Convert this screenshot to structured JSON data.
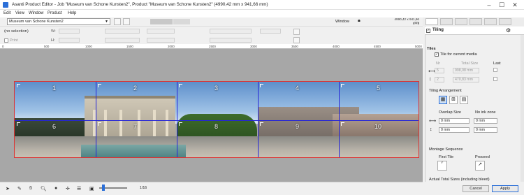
{
  "window": {
    "title": "Asanti Product Editor - Job \"Museum van Schone Kunsten2\", Product \"Museum van Schone Kunsten2\" (4990,42 mm x 941,66 mm)"
  },
  "menu": [
    "Edit",
    "View",
    "Window",
    "Product",
    "Help"
  ],
  "toolbar": {
    "product_select": "Museum van Schone Kunsten2",
    "window_label": "Window",
    "size_readout": "4990,42 x 941,66 mm",
    "page_readout": "8 / 1"
  },
  "properties": {
    "selection": "(no selection)",
    "print_label": "Print",
    "w_label": "W:",
    "h_label": "H:"
  },
  "ruler": {
    "ticks": [
      "0",
      "500",
      "1000",
      "1500",
      "2000",
      "2500",
      "3000",
      "3500",
      "4000",
      "4500",
      "5000"
    ]
  },
  "tiles": {
    "numbers": [
      "1",
      "2",
      "3",
      "4",
      "5",
      "6",
      "7",
      "8",
      "9",
      "10"
    ]
  },
  "status": {
    "zoom": "1/16"
  },
  "panel": {
    "title": "Tiling",
    "tiles_header": "Tiles",
    "tile_current_media": "Tile for current media",
    "nr_label": "Nr",
    "total_size_label": "Total Size",
    "last_label": "Last",
    "count_h": "5",
    "count_v": "2",
    "size_h": "998,08 mm",
    "size_v": "470,83 mm",
    "arrangement_header": "Tiling Arrangement",
    "overlap_label": "Overlap Size",
    "no_ink_label": "No ink zone",
    "overlap_h": "0 mm",
    "overlap_v": "0 mm",
    "noink_h": "0 mm",
    "noink_v": "0 mm",
    "montage_header": "Montage Sequence",
    "first_tile_label": "First Tile",
    "proceed_label": "Proceed",
    "actual_total": "Actual Total Sizes (including bleed)"
  },
  "buttons": {
    "cancel": "Cancel",
    "apply": "Apply"
  },
  "colors": {
    "accent": "#2b6fd8",
    "tile_lines": "#2424d8",
    "image_border": "#dd3333"
  }
}
